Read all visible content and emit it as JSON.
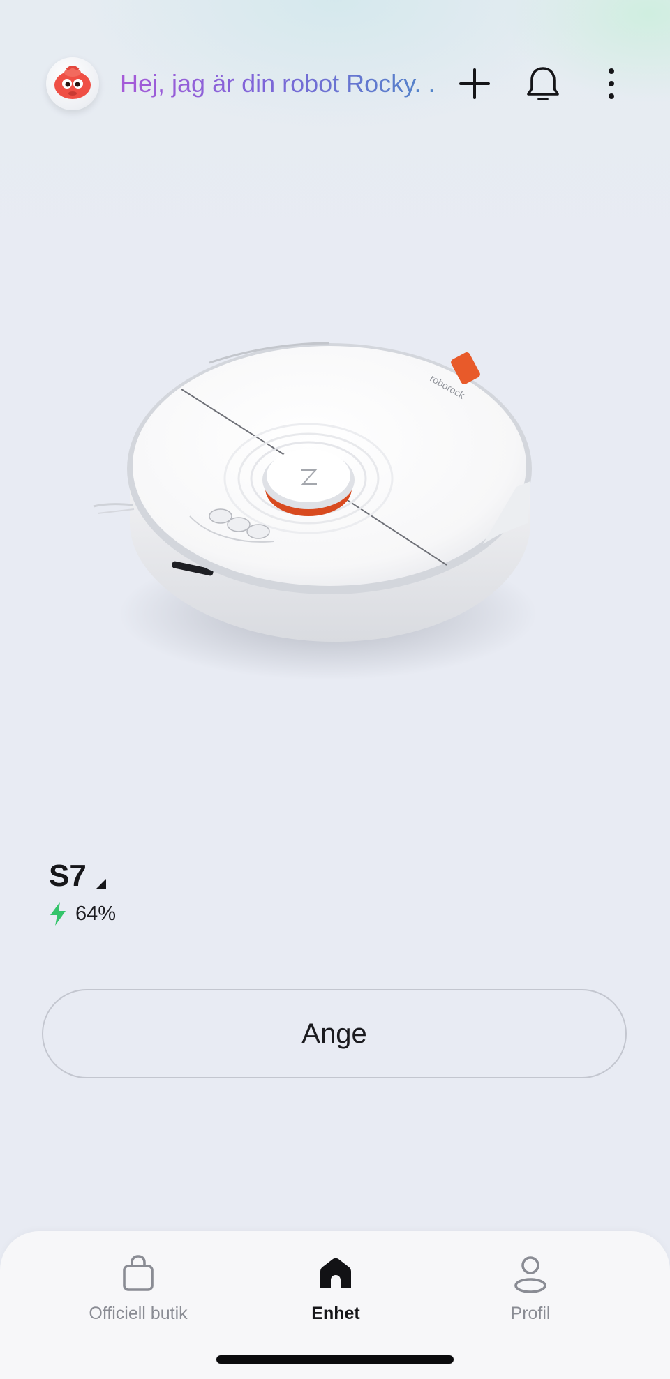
{
  "header": {
    "greeting": "Hej, jag är din robot Rocky. .",
    "avatar_icon": "robot-mascot-icon",
    "add_icon": "plus-icon",
    "notifications_icon": "bell-icon",
    "more_icon": "more-vertical-icon"
  },
  "device": {
    "name": "S7",
    "signal_icon": "signal-icon",
    "battery_icon": "lightning-bolt-icon",
    "battery_level": "64%",
    "battery_fraction": 0.64,
    "image_icon": "robot-vacuum-image",
    "brand_mark": "roborock"
  },
  "actions": {
    "enter_label": "Ange"
  },
  "nav": {
    "items": [
      {
        "label": "Officiell butik",
        "icon": "shopping-bag-icon",
        "active": false
      },
      {
        "label": "Enhet",
        "icon": "home-icon",
        "active": true
      },
      {
        "label": "Profil",
        "icon": "person-icon",
        "active": false
      }
    ]
  },
  "colors": {
    "background": "#e8ebf3",
    "accent_orange": "#e85a2a",
    "battery_green": "#34c46a",
    "greeting_gradient_start": "#a65ad8",
    "greeting_gradient_end": "#4f86c8"
  }
}
